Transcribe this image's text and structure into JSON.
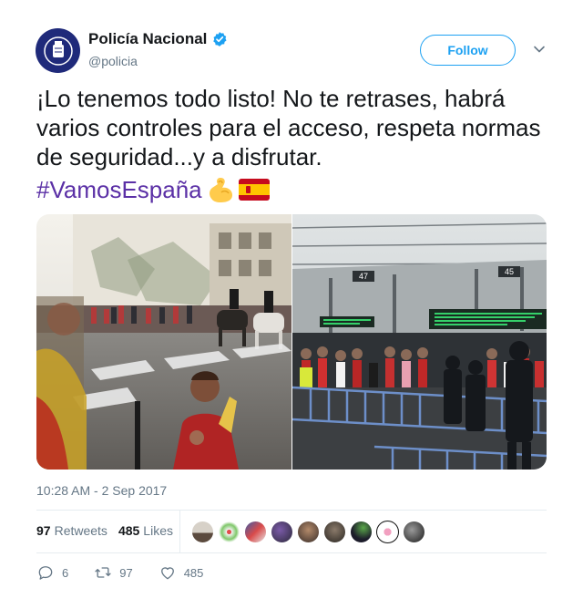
{
  "author": {
    "name": "Policía Nacional",
    "handle": "@policia"
  },
  "follow_label": "Follow",
  "tweet": {
    "text": "¡Lo tenemos todo listo! No te retrases, habrá varios controles para el acceso, respeta normas de seguridad...y a disfrutar.",
    "hashtag": "#VamosEspaña",
    "emojis": [
      "flexed-biceps-emoji",
      "spain-flag-emoji"
    ]
  },
  "media": {
    "photo2_signs": [
      "47",
      "45"
    ]
  },
  "timestamp": "10:28 AM - 2 Sep 2017",
  "stats": {
    "retweets_count": "97",
    "retweets_label": "Retweets",
    "likes_count": "485",
    "likes_label": "Likes"
  },
  "actions": {
    "replies": "6",
    "retweets": "97",
    "likes": "485"
  },
  "colors": {
    "link": "#1da1f2",
    "hashtag": "#5b30a6",
    "muted": "#657786"
  }
}
